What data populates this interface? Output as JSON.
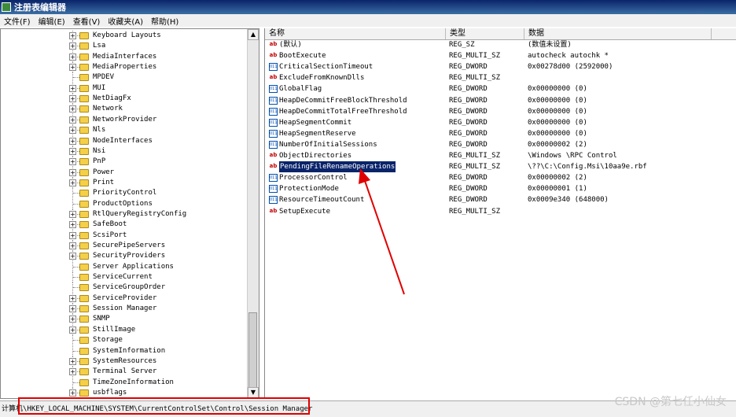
{
  "window": {
    "title": "注册表编辑器"
  },
  "menu": [
    "文件(F)",
    "编辑(E)",
    "查看(V)",
    "收藏夹(A)",
    "帮助(H)"
  ],
  "tree": {
    "items": [
      {
        "label": "Keyboard Layouts",
        "expandable": true
      },
      {
        "label": "Lsa",
        "expandable": true
      },
      {
        "label": "MediaInterfaces",
        "expandable": true
      },
      {
        "label": "MediaProperties",
        "expandable": true
      },
      {
        "label": "MPDEV",
        "expandable": false
      },
      {
        "label": "MUI",
        "expandable": true
      },
      {
        "label": "NetDiagFx",
        "expandable": true
      },
      {
        "label": "Network",
        "expandable": true
      },
      {
        "label": "NetworkProvider",
        "expandable": true
      },
      {
        "label": "Nls",
        "expandable": true
      },
      {
        "label": "NodeInterfaces",
        "expandable": true
      },
      {
        "label": "Nsi",
        "expandable": true
      },
      {
        "label": "PnP",
        "expandable": true
      },
      {
        "label": "Power",
        "expandable": true
      },
      {
        "label": "Print",
        "expandable": true
      },
      {
        "label": "PriorityControl",
        "expandable": false
      },
      {
        "label": "ProductOptions",
        "expandable": false
      },
      {
        "label": "RtlQueryRegistryConfig",
        "expandable": true
      },
      {
        "label": "SafeBoot",
        "expandable": true
      },
      {
        "label": "ScsiPort",
        "expandable": true
      },
      {
        "label": "SecurePipeServers",
        "expandable": true
      },
      {
        "label": "SecurityProviders",
        "expandable": true
      },
      {
        "label": "Server Applications",
        "expandable": false
      },
      {
        "label": "ServiceCurrent",
        "expandable": false
      },
      {
        "label": "ServiceGroupOrder",
        "expandable": false
      },
      {
        "label": "ServiceProvider",
        "expandable": true
      },
      {
        "label": "Session Manager",
        "expandable": true
      },
      {
        "label": "SNMP",
        "expandable": true
      },
      {
        "label": "StillImage",
        "expandable": true
      },
      {
        "label": "Storage",
        "expandable": false
      },
      {
        "label": "SystemInformation",
        "expandable": false
      },
      {
        "label": "SystemResources",
        "expandable": true
      },
      {
        "label": "Terminal Server",
        "expandable": true
      },
      {
        "label": "TimeZoneInformation",
        "expandable": false
      },
      {
        "label": "usbflags",
        "expandable": true
      }
    ]
  },
  "list": {
    "headers": {
      "name": "名称",
      "type": "类型",
      "data": "数据"
    },
    "rows": [
      {
        "icon": "string-value-icon",
        "name": "(默认)",
        "type": "REG_SZ",
        "data": "(数值未设置)"
      },
      {
        "icon": "string-value-icon",
        "name": "BootExecute",
        "type": "REG_MULTI_SZ",
        "data": "autocheck autochk *"
      },
      {
        "icon": "binary-value-icon",
        "name": "CriticalSectionTimeout",
        "type": "REG_DWORD",
        "data": "0x00278d00 (2592000)"
      },
      {
        "icon": "string-value-icon",
        "name": "ExcludeFromKnownDlls",
        "type": "REG_MULTI_SZ",
        "data": ""
      },
      {
        "icon": "binary-value-icon",
        "name": "GlobalFlag",
        "type": "REG_DWORD",
        "data": "0x00000000 (0)"
      },
      {
        "icon": "binary-value-icon",
        "name": "HeapDeCommitFreeBlockThreshold",
        "type": "REG_DWORD",
        "data": "0x00000000 (0)"
      },
      {
        "icon": "binary-value-icon",
        "name": "HeapDeCommitTotalFreeThreshold",
        "type": "REG_DWORD",
        "data": "0x00000000 (0)"
      },
      {
        "icon": "binary-value-icon",
        "name": "HeapSegmentCommit",
        "type": "REG_DWORD",
        "data": "0x00000000 (0)"
      },
      {
        "icon": "binary-value-icon",
        "name": "HeapSegmentReserve",
        "type": "REG_DWORD",
        "data": "0x00000000 (0)"
      },
      {
        "icon": "binary-value-icon",
        "name": "NumberOfInitialSessions",
        "type": "REG_DWORD",
        "data": "0x00000002 (2)"
      },
      {
        "icon": "string-value-icon",
        "name": "ObjectDirectories",
        "type": "REG_MULTI_SZ",
        "data": "\\Windows \\RPC Control"
      },
      {
        "icon": "string-value-icon",
        "name": "PendingFileRenameOperations",
        "type": "REG_MULTI_SZ",
        "data": "\\??\\C:\\Config.Msi\\10aa9e.rbf",
        "selected": true
      },
      {
        "icon": "binary-value-icon",
        "name": "ProcessorControl",
        "type": "REG_DWORD",
        "data": "0x00000002 (2)"
      },
      {
        "icon": "binary-value-icon",
        "name": "ProtectionMode",
        "type": "REG_DWORD",
        "data": "0x00000001 (1)"
      },
      {
        "icon": "binary-value-icon",
        "name": "ResourceTimeoutCount",
        "type": "REG_DWORD",
        "data": "0x0009e340 (648000)"
      },
      {
        "icon": "string-value-icon",
        "name": "SetupExecute",
        "type": "REG_MULTI_SZ",
        "data": ""
      }
    ]
  },
  "status": {
    "path": "计算机\\HKEY_LOCAL_MACHINE\\SYSTEM\\CurrentControlSet\\Control\\Session Manager"
  },
  "watermark": "CSDN @第七任小仙女",
  "colors": {
    "highlight": "#e00000",
    "selection": "#0a246a"
  }
}
